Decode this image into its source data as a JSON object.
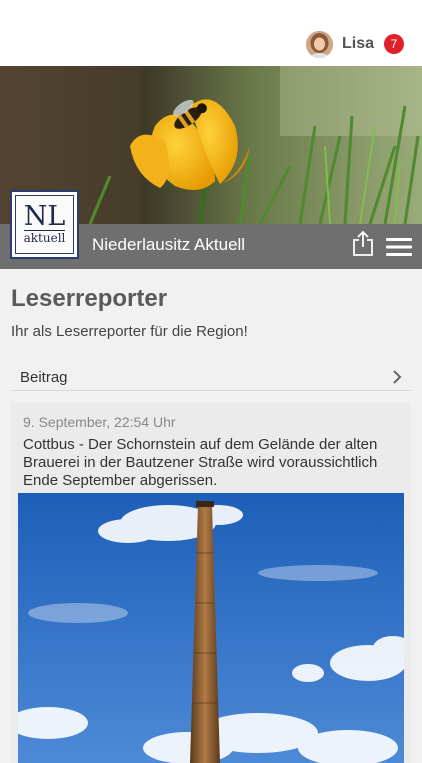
{
  "header": {
    "user_name": "Lisa",
    "notification_count": "7"
  },
  "brand": {
    "logo_main": "NL",
    "logo_sub": "aktuell",
    "name": "Niederlausitz Aktuell"
  },
  "page": {
    "title": "Leserreporter",
    "subtitle": "Ihr als Leserreporter für die Region!"
  },
  "section": {
    "label": "Beitrag"
  },
  "post": {
    "date": "9. September, 22:54 Uhr",
    "text": "Cottbus - Der Schornstein auf dem Gelände der alten Brauerei in der Bautzener Straße wird voraussichtlich Ende September abgerissen."
  },
  "colors": {
    "badge": "#e0202a",
    "brand_bar": "#6f6f6f",
    "logo_border": "#2b3c6e"
  },
  "icons": [
    "avatar",
    "share-icon",
    "menu-icon",
    "chevron-right-icon"
  ]
}
